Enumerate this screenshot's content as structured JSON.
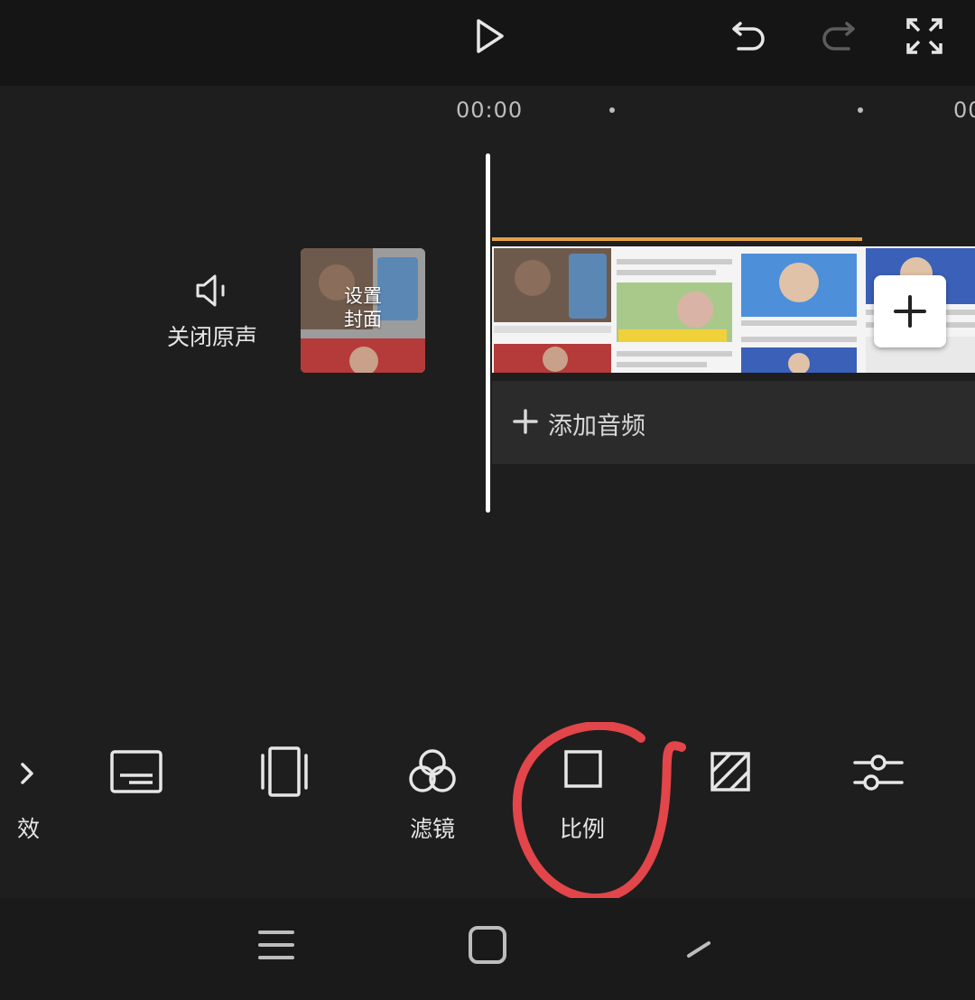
{
  "timeline": {
    "time_start": "00:00",
    "time_next": "00"
  },
  "audio_toggle": {
    "label": "关闭原声",
    "icon": "speaker-icon"
  },
  "cover": {
    "label_line1": "设置",
    "label_line2": "封面"
  },
  "add_audio": {
    "label": "添加音频"
  },
  "toolbar": {
    "items": [
      {
        "icon": "tool-partial-icon",
        "label": "效"
      },
      {
        "icon": "subtitle-icon",
        "label": ""
      },
      {
        "icon": "frame-icon",
        "label": ""
      },
      {
        "icon": "filter-icon",
        "label": "滤镜"
      },
      {
        "icon": "ratio-icon",
        "label": "比例"
      },
      {
        "icon": "background-icon",
        "label": ""
      },
      {
        "icon": "adjust-icon",
        "label": ""
      }
    ]
  },
  "colors": {
    "background": "#1e1e1e",
    "topbar": "#151515",
    "accent_orange": "#e0a24a",
    "annotation_red": "#e2454a"
  }
}
